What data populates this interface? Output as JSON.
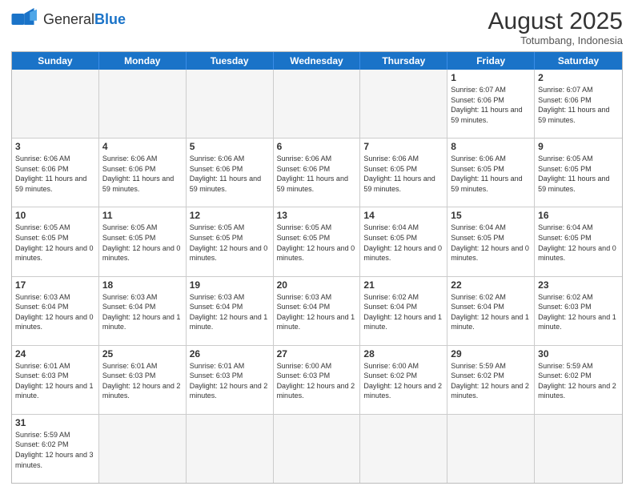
{
  "header": {
    "logo_general": "General",
    "logo_blue": "Blue",
    "month_year": "August 2025",
    "location": "Totumbang, Indonesia"
  },
  "days_of_week": [
    "Sunday",
    "Monday",
    "Tuesday",
    "Wednesday",
    "Thursday",
    "Friday",
    "Saturday"
  ],
  "weeks": [
    [
      {
        "day": "",
        "info": "",
        "empty": true
      },
      {
        "day": "",
        "info": "",
        "empty": true
      },
      {
        "day": "",
        "info": "",
        "empty": true
      },
      {
        "day": "",
        "info": "",
        "empty": true
      },
      {
        "day": "",
        "info": "",
        "empty": true
      },
      {
        "day": "1",
        "info": "Sunrise: 6:07 AM\nSunset: 6:06 PM\nDaylight: 11 hours and 59 minutes."
      },
      {
        "day": "2",
        "info": "Sunrise: 6:07 AM\nSunset: 6:06 PM\nDaylight: 11 hours and 59 minutes."
      }
    ],
    [
      {
        "day": "3",
        "info": "Sunrise: 6:06 AM\nSunset: 6:06 PM\nDaylight: 11 hours and 59 minutes."
      },
      {
        "day": "4",
        "info": "Sunrise: 6:06 AM\nSunset: 6:06 PM\nDaylight: 11 hours and 59 minutes."
      },
      {
        "day": "5",
        "info": "Sunrise: 6:06 AM\nSunset: 6:06 PM\nDaylight: 11 hours and 59 minutes."
      },
      {
        "day": "6",
        "info": "Sunrise: 6:06 AM\nSunset: 6:06 PM\nDaylight: 11 hours and 59 minutes."
      },
      {
        "day": "7",
        "info": "Sunrise: 6:06 AM\nSunset: 6:05 PM\nDaylight: 11 hours and 59 minutes."
      },
      {
        "day": "8",
        "info": "Sunrise: 6:06 AM\nSunset: 6:05 PM\nDaylight: 11 hours and 59 minutes."
      },
      {
        "day": "9",
        "info": "Sunrise: 6:05 AM\nSunset: 6:05 PM\nDaylight: 11 hours and 59 minutes."
      }
    ],
    [
      {
        "day": "10",
        "info": "Sunrise: 6:05 AM\nSunset: 6:05 PM\nDaylight: 12 hours and 0 minutes."
      },
      {
        "day": "11",
        "info": "Sunrise: 6:05 AM\nSunset: 6:05 PM\nDaylight: 12 hours and 0 minutes."
      },
      {
        "day": "12",
        "info": "Sunrise: 6:05 AM\nSunset: 6:05 PM\nDaylight: 12 hours and 0 minutes."
      },
      {
        "day": "13",
        "info": "Sunrise: 6:05 AM\nSunset: 6:05 PM\nDaylight: 12 hours and 0 minutes."
      },
      {
        "day": "14",
        "info": "Sunrise: 6:04 AM\nSunset: 6:05 PM\nDaylight: 12 hours and 0 minutes."
      },
      {
        "day": "15",
        "info": "Sunrise: 6:04 AM\nSunset: 6:05 PM\nDaylight: 12 hours and 0 minutes."
      },
      {
        "day": "16",
        "info": "Sunrise: 6:04 AM\nSunset: 6:05 PM\nDaylight: 12 hours and 0 minutes."
      }
    ],
    [
      {
        "day": "17",
        "info": "Sunrise: 6:03 AM\nSunset: 6:04 PM\nDaylight: 12 hours and 0 minutes."
      },
      {
        "day": "18",
        "info": "Sunrise: 6:03 AM\nSunset: 6:04 PM\nDaylight: 12 hours and 1 minute."
      },
      {
        "day": "19",
        "info": "Sunrise: 6:03 AM\nSunset: 6:04 PM\nDaylight: 12 hours and 1 minute."
      },
      {
        "day": "20",
        "info": "Sunrise: 6:03 AM\nSunset: 6:04 PM\nDaylight: 12 hours and 1 minute."
      },
      {
        "day": "21",
        "info": "Sunrise: 6:02 AM\nSunset: 6:04 PM\nDaylight: 12 hours and 1 minute."
      },
      {
        "day": "22",
        "info": "Sunrise: 6:02 AM\nSunset: 6:04 PM\nDaylight: 12 hours and 1 minute."
      },
      {
        "day": "23",
        "info": "Sunrise: 6:02 AM\nSunset: 6:03 PM\nDaylight: 12 hours and 1 minute."
      }
    ],
    [
      {
        "day": "24",
        "info": "Sunrise: 6:01 AM\nSunset: 6:03 PM\nDaylight: 12 hours and 1 minute."
      },
      {
        "day": "25",
        "info": "Sunrise: 6:01 AM\nSunset: 6:03 PM\nDaylight: 12 hours and 2 minutes."
      },
      {
        "day": "26",
        "info": "Sunrise: 6:01 AM\nSunset: 6:03 PM\nDaylight: 12 hours and 2 minutes."
      },
      {
        "day": "27",
        "info": "Sunrise: 6:00 AM\nSunset: 6:03 PM\nDaylight: 12 hours and 2 minutes."
      },
      {
        "day": "28",
        "info": "Sunrise: 6:00 AM\nSunset: 6:02 PM\nDaylight: 12 hours and 2 minutes."
      },
      {
        "day": "29",
        "info": "Sunrise: 5:59 AM\nSunset: 6:02 PM\nDaylight: 12 hours and 2 minutes."
      },
      {
        "day": "30",
        "info": "Sunrise: 5:59 AM\nSunset: 6:02 PM\nDaylight: 12 hours and 2 minutes."
      }
    ],
    [
      {
        "day": "31",
        "info": "Sunrise: 5:59 AM\nSunset: 6:02 PM\nDaylight: 12 hours and 3 minutes."
      },
      {
        "day": "",
        "info": "",
        "empty": true
      },
      {
        "day": "",
        "info": "",
        "empty": true
      },
      {
        "day": "",
        "info": "",
        "empty": true
      },
      {
        "day": "",
        "info": "",
        "empty": true
      },
      {
        "day": "",
        "info": "",
        "empty": true
      },
      {
        "day": "",
        "info": "",
        "empty": true
      }
    ]
  ]
}
